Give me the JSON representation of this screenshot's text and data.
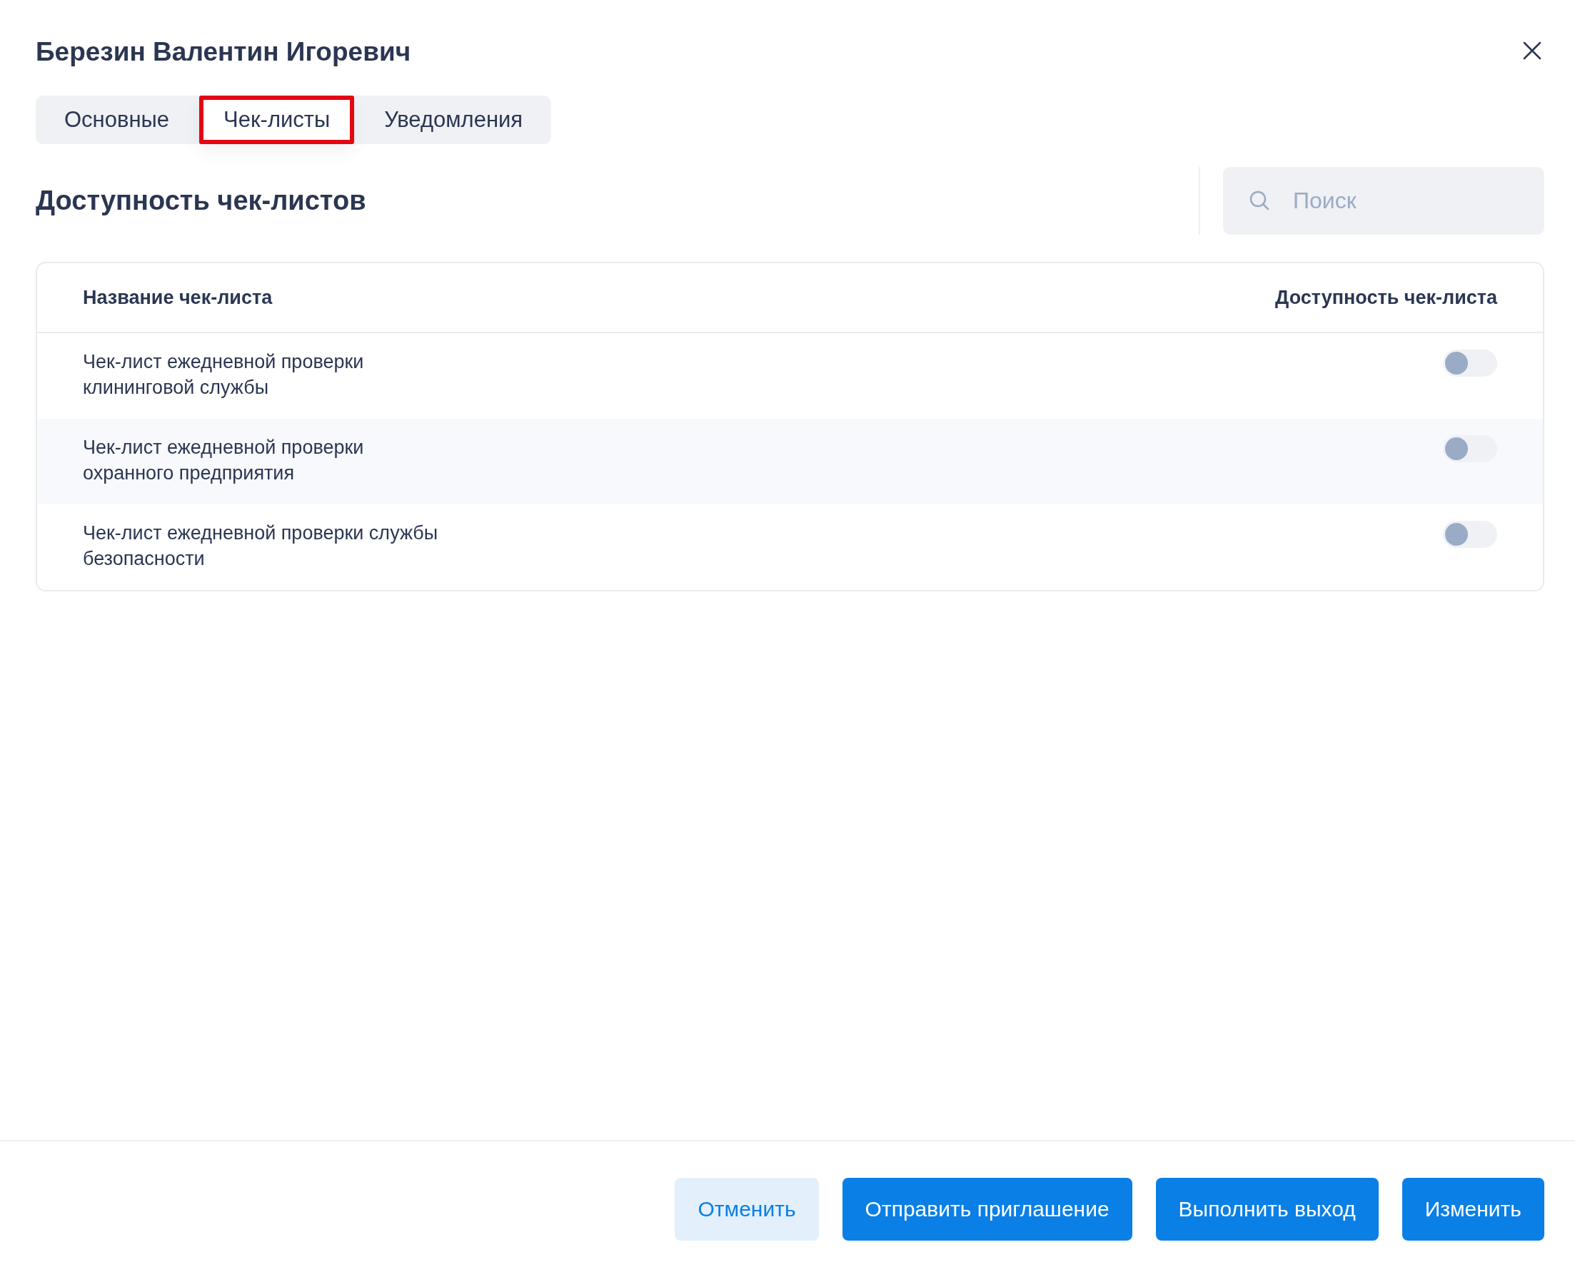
{
  "dialog": {
    "title": "Березин Валентин Игоревич"
  },
  "tabs": [
    {
      "label": "Основные",
      "selected": false
    },
    {
      "label": "Чек-листы",
      "selected": true
    },
    {
      "label": "Уведомления",
      "selected": false
    }
  ],
  "section": {
    "title": "Доступность чек-листов"
  },
  "search": {
    "placeholder": "Поиск"
  },
  "table": {
    "columns": [
      "Название чек-листа",
      "Доступность чек-листа"
    ],
    "rows": [
      {
        "name": "Чек-лист ежедневной проверки клининговой службы",
        "on": false
      },
      {
        "name": "Чек-лист ежедневной проверки охранного предприятия",
        "on": false
      },
      {
        "name": "Чек-лист ежедневной проверки службы безопасности",
        "on": false
      }
    ]
  },
  "buttons": [
    {
      "label": "Отменить",
      "kind": "secondary"
    },
    {
      "label": "Отправить приглашение",
      "kind": "primary"
    },
    {
      "label": "Выполнить выход",
      "kind": "primary"
    },
    {
      "label": "Изменить",
      "kind": "primary"
    }
  ]
}
